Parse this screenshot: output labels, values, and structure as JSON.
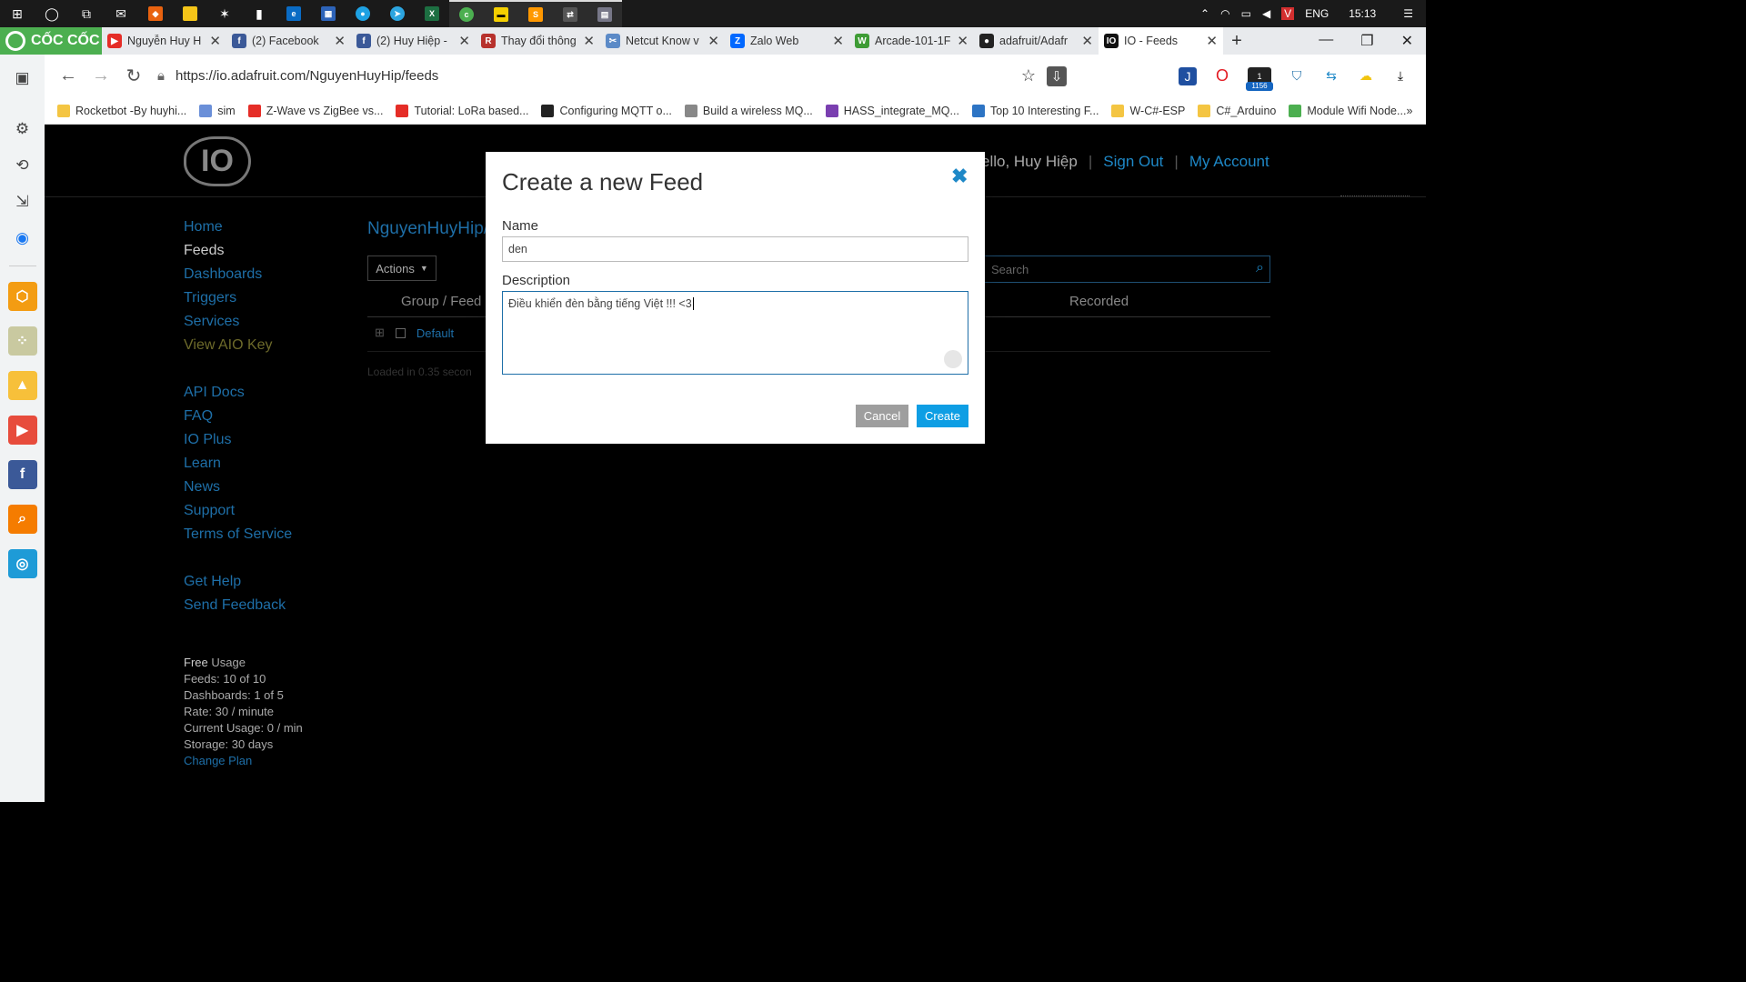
{
  "taskbar": {
    "lang": "ENG",
    "time": "15:13"
  },
  "browser": {
    "brand": "CỐC CỐC",
    "tabs": [
      {
        "title": "Nguyễn Huy H",
        "color": "#e52d27",
        "glyph": "▶"
      },
      {
        "title": "(2) Facebook",
        "color": "#3b5998",
        "glyph": "f"
      },
      {
        "title": "(2) Huy Hiệp -",
        "color": "#3b5998",
        "glyph": "f"
      },
      {
        "title": "Thay đổi thông",
        "color": "#b7312c",
        "glyph": "R"
      },
      {
        "title": "Netcut Know v",
        "color": "#5b8ac7",
        "glyph": "✂"
      },
      {
        "title": "Zalo Web",
        "color": "#0068ff",
        "glyph": "Z"
      },
      {
        "title": "Arcade-101-1F",
        "color": "#3e9c35",
        "glyph": "W"
      },
      {
        "title": "adafruit/Adafr",
        "color": "#222222",
        "glyph": "●"
      },
      {
        "title": "IO - Feeds",
        "color": "#111111",
        "glyph": "IO"
      }
    ],
    "url": "https://io.adafruit.com/NguyenHuyHip/feeds",
    "ext_badge": "1156",
    "bookmarks": [
      {
        "label": "Rocketbot -By huyhi...",
        "color": "#f4c542"
      },
      {
        "label": "sim",
        "color": "#6a8fd8"
      },
      {
        "label": "Z-Wave vs ZigBee vs...",
        "color": "#e52d27"
      },
      {
        "label": "Tutorial: LoRa based...",
        "color": "#e52d27"
      },
      {
        "label": "Configuring MQTT o...",
        "color": "#222222"
      },
      {
        "label": "Build a wireless MQ...",
        "color": "#888888"
      },
      {
        "label": "HASS_integrate_MQ...",
        "color": "#7a3fb0"
      },
      {
        "label": "Top 10 Interesting F...",
        "color": "#2d74c4"
      },
      {
        "label": "W-C#-ESP",
        "color": "#f4c542"
      },
      {
        "label": "C#_Arduino",
        "color": "#f4c542"
      },
      {
        "label": "Module Wifi Node...",
        "color": "#4caf50"
      }
    ]
  },
  "site": {
    "greeting": "ello, Huy Hiệp",
    "sign_out": "Sign Out",
    "my_account": "My Account",
    "nav": [
      "Home",
      "Feeds",
      "Dashboards",
      "Triggers",
      "Services",
      "View AIO Key"
    ],
    "nav2": [
      "API Docs",
      "FAQ",
      "IO Plus",
      "Learn",
      "News",
      "Support",
      "Terms of Service"
    ],
    "nav3": [
      "Get Help",
      "Send Feedback"
    ],
    "usage": {
      "free": "Free",
      "usage_label": " Usage",
      "feeds": "Feeds: 10 of 10",
      "dashboards": "Dashboards: 1 of 5",
      "rate": "Rate: 30 / minute",
      "current": "Current Usage: 0 / min",
      "storage": "Storage: 30 days",
      "change_plan": "Change Plan"
    },
    "feed_title": "NguyenHuyHip/",
    "actions": "Actions",
    "search_placeholder": "Search",
    "col_group_feed": "Group / Feed",
    "col_recorded": "Recorded",
    "default_group": "Default",
    "loaded": "Loaded in 0.35 secon"
  },
  "modal": {
    "title": "Create a new Feed",
    "name_label": "Name",
    "name_value": "den",
    "desc_label": "Description",
    "desc_value": "Điều khiển đèn bằng tiếng Việt !!! <3",
    "cancel": "Cancel",
    "create": "Create"
  }
}
